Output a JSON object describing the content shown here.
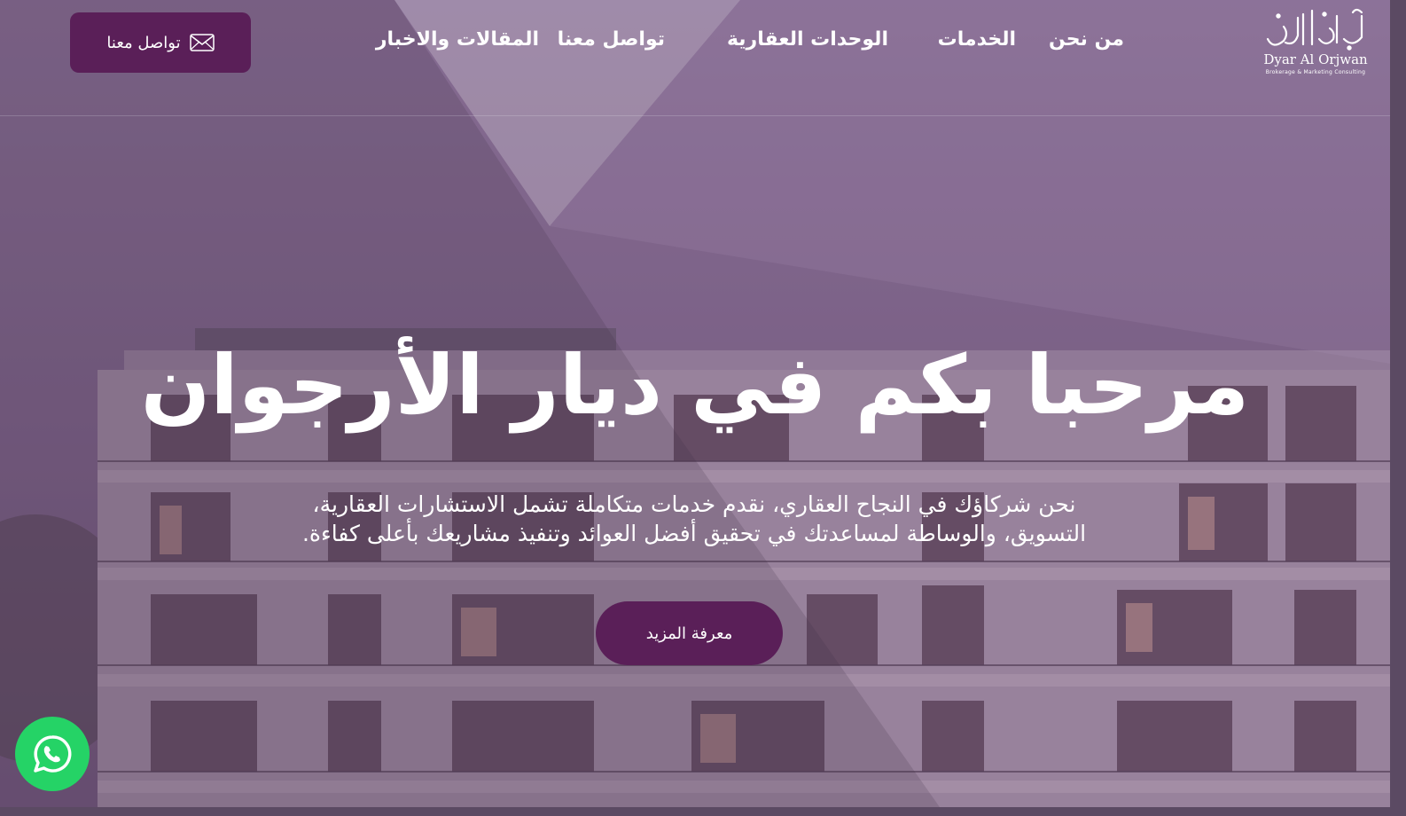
{
  "brand": {
    "name_en": "Dyar Al Orjwan",
    "tagline": "Brokerage & Marketing Consulting"
  },
  "nav": {
    "items": [
      {
        "label": "من نحن"
      },
      {
        "label": "الخدمات"
      },
      {
        "label": "الوحدات العقارية"
      },
      {
        "label": "تواصل معنا"
      },
      {
        "label": "المقالات والاخبار"
      }
    ]
  },
  "header_cta": {
    "label": "تواصل معنا",
    "icon": "mail-icon"
  },
  "hero": {
    "title": "مرحبا بكم في ديار الأرجوان",
    "text": "نحن شركاؤك في النجاح العقاري، نقدم خدمات متكاملة تشمل الاستشارات العقارية، التسويق، والوساطة لمساعدتك في تحقيق أفضل العوائد وتنفيذ مشاريعك بأعلى كفاءة.",
    "button": "معرفة المزيد"
  },
  "floating": {
    "whatsapp_icon": "whatsapp-icon"
  },
  "colors": {
    "accent": "#5a1f58",
    "overlay": "#7a6385",
    "whatsapp": "#25d366",
    "text": "#ffffff"
  }
}
